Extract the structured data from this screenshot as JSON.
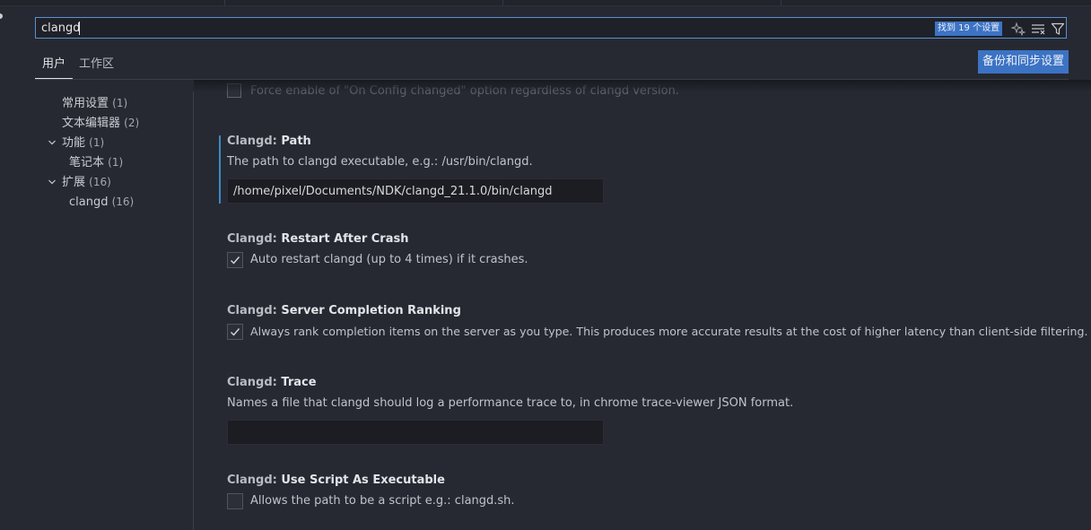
{
  "search": {
    "value": "clangd",
    "result_count": "找到 19 个设置",
    "icons": [
      "sparkle-icon",
      "clear-filter-icon",
      "filter-icon"
    ]
  },
  "tabs": {
    "user": "用户",
    "workspace": "工作区"
  },
  "sync_button": "备份和同步设置",
  "toc": {
    "common": {
      "label": "常用设置",
      "count": "(1)"
    },
    "text_editor": {
      "label": "文本编辑器",
      "count": "(2)"
    },
    "features": {
      "label": "功能",
      "count": "(1)"
    },
    "notebook": {
      "label": "笔记本",
      "count": "(1)"
    },
    "extensions": {
      "label": "扩展",
      "count": "(16)"
    },
    "clangd": {
      "label": "clangd",
      "count": "(16)"
    }
  },
  "settings": {
    "prev_desc": "Force enable of \"On Config changed\" option regardless of clangd version.",
    "path": {
      "category": "Clangd: ",
      "name": "Path",
      "description": "The path to clangd executable, e.g.: /usr/bin/clangd.",
      "value": "/home/pixel/Documents/NDK/clangd_21.1.0/bin/clangd"
    },
    "restart": {
      "category": "Clangd: ",
      "name": "Restart After Crash",
      "description": "Auto restart clangd (up to 4 times) if it crashes.",
      "checked": true
    },
    "ranking": {
      "category": "Clangd: ",
      "name": "Server Completion Ranking",
      "description": "Always rank completion items on the server as you type. This produces more accurate results at the cost of higher latency than client-side filtering.",
      "checked": true
    },
    "trace": {
      "category": "Clangd: ",
      "name": "Trace",
      "description": "Names a file that clangd should log a performance trace to, in chrome trace-viewer JSON format.",
      "value": ""
    },
    "script": {
      "category": "Clangd: ",
      "name": "Use Script As Executable",
      "description": "Allows the path to be a script e.g.: clangd.sh.",
      "checked": false
    }
  },
  "colors": {
    "accent": "#3c73c4",
    "focus": "#3c8ac4",
    "background": "#262931"
  }
}
